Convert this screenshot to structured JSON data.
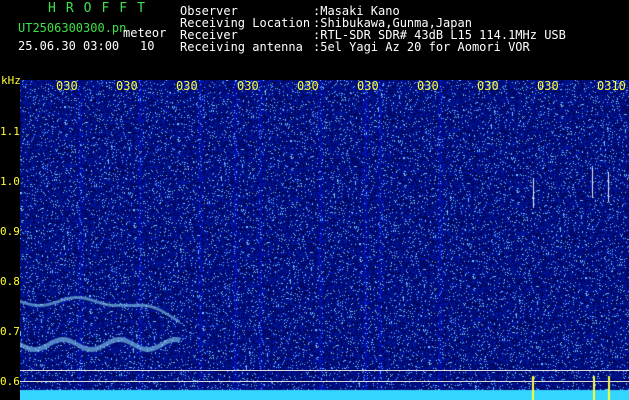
{
  "header": {
    "title": "HROFFT",
    "filename": "UT2506300300.pn",
    "mode": "meteor",
    "datetime": "25.06.30 03:00",
    "count": "10"
  },
  "info": {
    "labels": [
      "Observer",
      "Receiving Location",
      "Receiver",
      "Receiving antenna"
    ],
    "values": [
      ":Masaki Kano",
      ":Shibukawa,Gunma,Japan",
      ":RTL-SDR SDR# 43dB L15 114.1MHz USB",
      ":5el Yagi Az 20 for Aomori VOR"
    ]
  },
  "axis": {
    "unit": "kHz",
    "yticks": [
      "1.1",
      "1.0",
      "0.9",
      "0.8",
      "0.7",
      "0.6"
    ],
    "time_marks": [
      "030",
      "030",
      "030",
      "030",
      "030",
      "030",
      "030",
      "030",
      "030",
      "0310"
    ]
  },
  "colors": {
    "background": "#000000",
    "signal_low": "#0a1a8c",
    "signal_mid": "#2f4fff",
    "signal_high": "#9fe8ff",
    "header_green": "#3fe04a",
    "tick_yellow": "#ffff33"
  }
}
